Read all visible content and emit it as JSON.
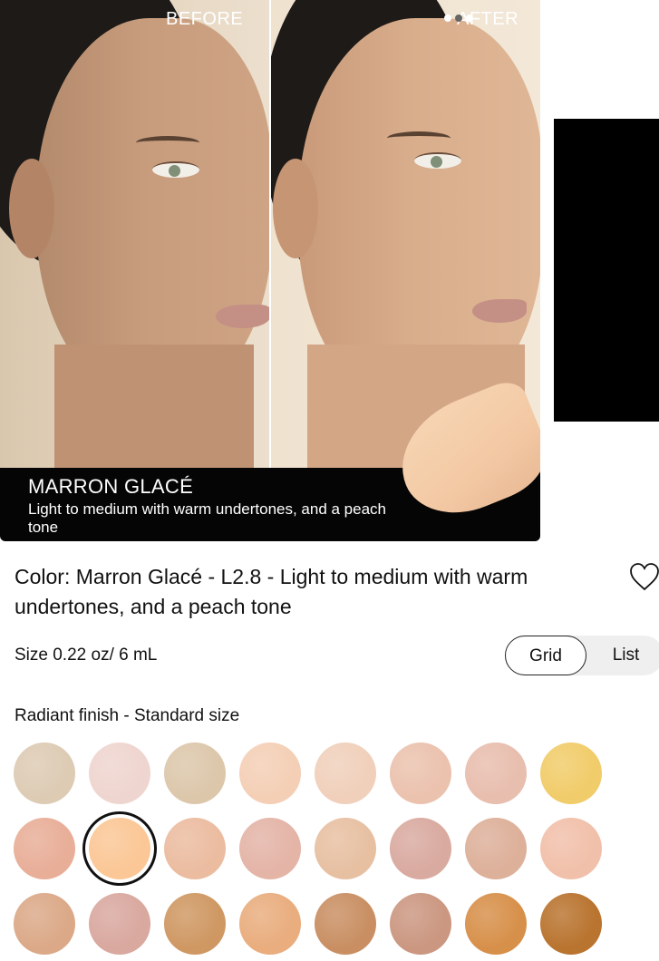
{
  "hero": {
    "before_label": "BEFORE",
    "after_label": "AFTER",
    "shade_name": "MARRON GLACÉ",
    "shade_description": "Light to medium with warm undertones, and a peach tone"
  },
  "product": {
    "color_label": "Color: Marron Glacé - L2.8 - Light to medium with warm undertones, and a peach tone",
    "size_label": "Size 0.22 oz/ 6 mL",
    "wishlist_icon": "heart-icon"
  },
  "view_toggle": {
    "grid_label": "Grid",
    "list_label": "List",
    "selected": "Grid"
  },
  "swatch_section": {
    "title": "Radiant finish - Standard size",
    "selected_index": 9,
    "swatches": [
      {
        "color": "#ddcbb4"
      },
      {
        "color": "#efd5cf"
      },
      {
        "color": "#dcc7ab"
      },
      {
        "color": "#f4cfb6"
      },
      {
        "color": "#f0d0bb"
      },
      {
        "color": "#ebc2ae"
      },
      {
        "color": "#e8beae"
      },
      {
        "color": "#f1cc6a"
      },
      {
        "color": "#e8ae98"
      },
      {
        "color": "#fbc796"
      },
      {
        "color": "#ebbca0"
      },
      {
        "color": "#e4b4a7"
      },
      {
        "color": "#e7c0a2"
      },
      {
        "color": "#d9aaa0"
      },
      {
        "color": "#ddb09a"
      },
      {
        "color": "#f1c0aa"
      },
      {
        "color": "#dba988"
      },
      {
        "color": "#d9a89f"
      },
      {
        "color": "#cf9863"
      },
      {
        "color": "#e9ad7e"
      },
      {
        "color": "#c98f63"
      },
      {
        "color": "#cb9781"
      },
      {
        "color": "#d7904a"
      },
      {
        "color": "#b9742f"
      }
    ]
  }
}
